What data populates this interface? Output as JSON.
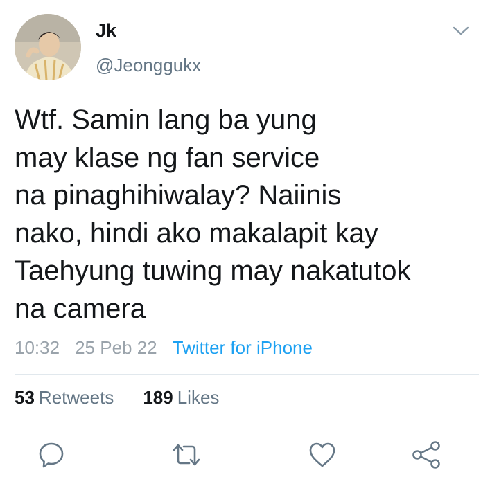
{
  "author": {
    "display_name": "Jk",
    "handle": "@Jeonggukx",
    "avatar_icon": "profile-photo"
  },
  "tweet": {
    "lines": [
      "Wtf. Samin lang ba yung",
      "may klase ng fan service",
      "na pinaghihiwalay? Naiinis",
      "nako, hindi ako makalapit kay",
      "Taehyung tuwing may nakatutok",
      "na camera"
    ],
    "time": "10:32",
    "date": "25 Peb 22",
    "source": "Twitter for iPhone"
  },
  "stats": {
    "retweets_count": "53",
    "retweets_label": "Retweets",
    "likes_count": "189",
    "likes_label": "Likes"
  },
  "actions": [
    "reply-icon",
    "retweet-icon",
    "like-icon",
    "share-icon"
  ],
  "colors": {
    "text": "#14171a",
    "secondary": "#657786",
    "link": "#1da1f2",
    "divider": "#e1e8ed",
    "icon": "#657786"
  }
}
